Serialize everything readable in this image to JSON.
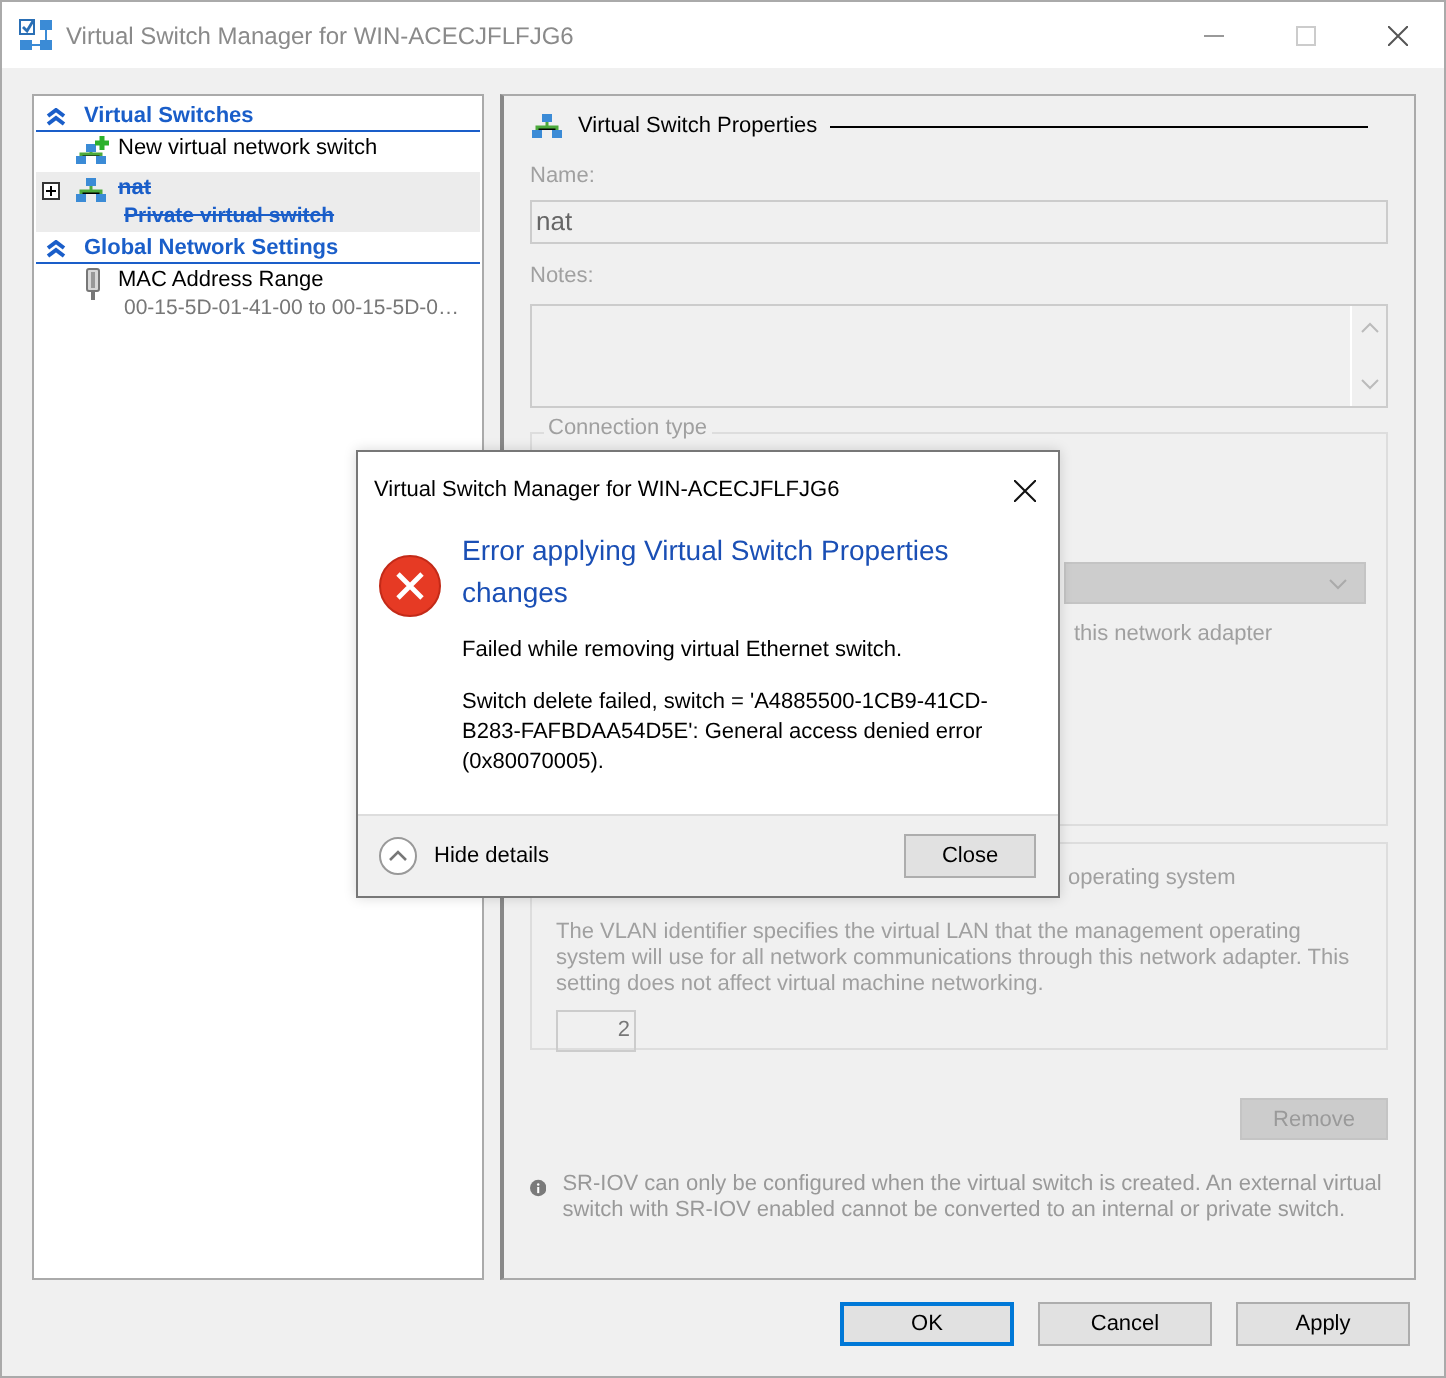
{
  "window": {
    "title": "Virtual Switch Manager for WIN-ACECJFLFJG6"
  },
  "sidebar": {
    "sections": [
      {
        "title": "Virtual Switches",
        "expanded": true,
        "items": [
          {
            "kind": "add",
            "label": "New virtual network switch",
            "selected": false,
            "pending_delete": false
          },
          {
            "kind": "switch",
            "label": "nat",
            "sublabel": "Private virtual switch",
            "selected": true,
            "pending_delete": true,
            "expandable": true
          }
        ]
      },
      {
        "title": "Global Network Settings",
        "expanded": true,
        "items": [
          {
            "kind": "mac",
            "label": "MAC Address Range",
            "sublabel": "00-15-5D-01-41-00 to 00-15-5D-0…",
            "selected": false,
            "pending_delete": false
          }
        ]
      }
    ]
  },
  "properties": {
    "title": "Virtual Switch Properties",
    "name_label": "Name:",
    "name_value": "nat",
    "notes_label": "Notes:",
    "connection_type_label": "Connection type",
    "adapter_hint": "this network adapter",
    "management_os_label": "operating system",
    "vlan_description": "The VLAN identifier specifies the virtual LAN that the management operating system will use for all network communications through this network adapter. This setting does not affect virtual machine networking.",
    "vlan_id": "2",
    "remove_button": "Remove",
    "info_text": "SR-IOV can only be configured when the virtual switch is created. An external virtual switch with SR-IOV enabled cannot be converted to an internal or private switch."
  },
  "buttons": [
    {
      "label": "OK",
      "default": true
    },
    {
      "label": "Cancel",
      "default": false
    },
    {
      "label": "Apply",
      "default": false
    }
  ],
  "dialog": {
    "title": "Virtual Switch Manager for WIN-ACECJFLFJG6",
    "heading": "Error applying Virtual Switch Properties changes",
    "message": "Failed while removing virtual Ethernet switch.",
    "details": "Switch delete failed, switch = 'A4885500-1CB9-41CD-B283-FAFBDAA54D5E': General access denied error (0x80070005).",
    "toggle_label": "Hide details",
    "close_button": "Close"
  }
}
